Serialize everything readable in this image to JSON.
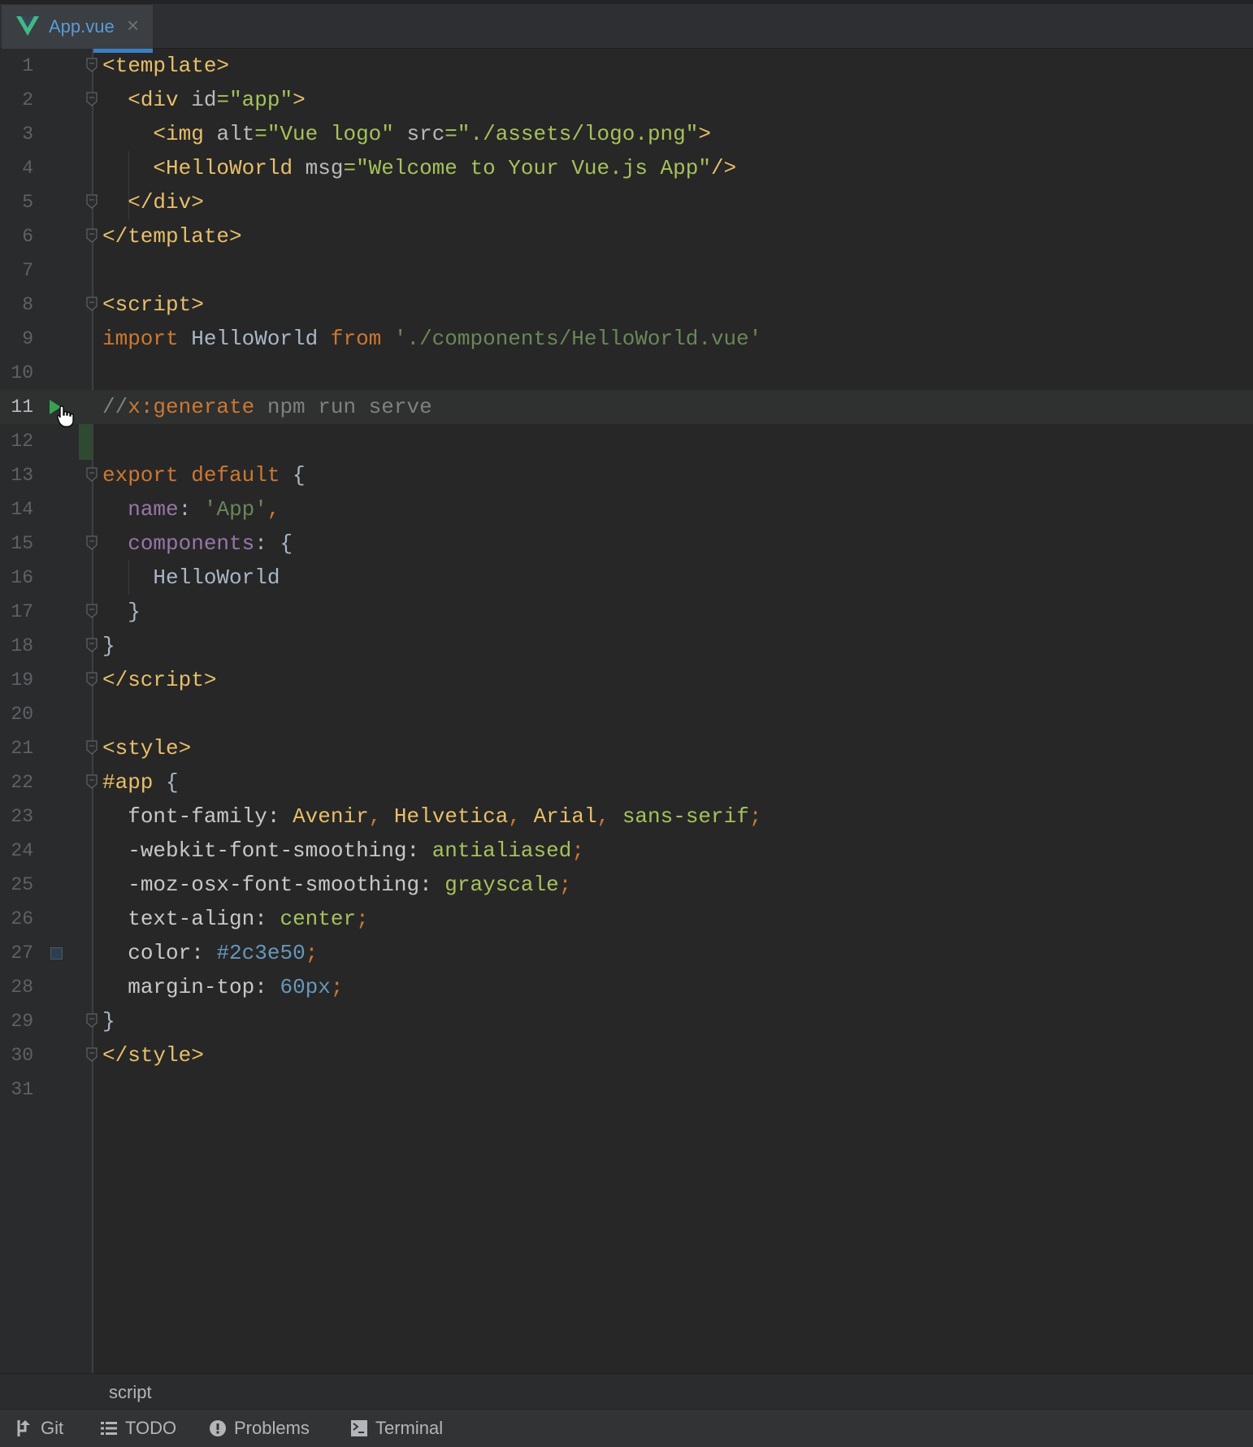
{
  "tab": {
    "label": "App.vue",
    "icon": "vue-logo-icon",
    "close_icon": "close-icon"
  },
  "lines": [
    [
      [
        "<template>",
        "tag"
      ]
    ],
    [
      [
        "  ",
        ""
      ],
      [
        "<div ",
        "tag"
      ],
      [
        "id",
        "attr"
      ],
      [
        "=",
        "str"
      ],
      [
        "\"app\"",
        "str"
      ],
      [
        ">",
        "tag"
      ]
    ],
    [
      [
        "    ",
        ""
      ],
      [
        "<img ",
        "tag"
      ],
      [
        "alt",
        "attr"
      ],
      [
        "=\"Vue logo\" ",
        "str"
      ],
      [
        "src",
        "attr"
      ],
      [
        "=\"./assets/logo.png\"",
        "str"
      ],
      [
        ">",
        "tag"
      ]
    ],
    [
      [
        "    ",
        ""
      ],
      [
        "<HelloWorld ",
        "tag"
      ],
      [
        "msg",
        "attr"
      ],
      [
        "=\"Welcome to Your Vue.js App\"",
        "str"
      ],
      [
        "/>",
        "tag"
      ]
    ],
    [
      [
        "  ",
        ""
      ],
      [
        "</div>",
        "tag"
      ]
    ],
    [
      [
        "</template>",
        "tag"
      ]
    ],
    [],
    [
      [
        "<script>",
        "tag"
      ]
    ],
    [
      [
        "import ",
        "kw"
      ],
      [
        "HelloWorld ",
        "id"
      ],
      [
        "from ",
        "kw"
      ],
      [
        "'./components/HelloWorld.vue'",
        "jstr"
      ]
    ],
    [],
    [
      [
        "//",
        "cmt"
      ],
      [
        "x:generate",
        "kw"
      ],
      [
        " npm run serve",
        "cmt"
      ]
    ],
    [],
    [
      [
        "export default ",
        "kw"
      ],
      [
        "{",
        "id"
      ]
    ],
    [
      [
        "  ",
        ""
      ],
      [
        "name",
        "prop"
      ],
      [
        ": ",
        "id"
      ],
      [
        "'App'",
        "jstr"
      ],
      [
        ",",
        "kw"
      ]
    ],
    [
      [
        "  ",
        ""
      ],
      [
        "components",
        "prop"
      ],
      [
        ": {",
        "id"
      ]
    ],
    [
      [
        "    ",
        ""
      ],
      [
        "HelloWorld",
        "id"
      ]
    ],
    [
      [
        "  ",
        ""
      ],
      [
        "}",
        "id"
      ]
    ],
    [
      [
        "}",
        "id"
      ]
    ],
    [
      [
        "</script>",
        "tag"
      ]
    ],
    [],
    [
      [
        "<style>",
        "tag"
      ]
    ],
    [
      [
        "#app ",
        "tag"
      ],
      [
        "{",
        "id"
      ]
    ],
    [
      [
        "  ",
        ""
      ],
      [
        "font-family",
        "cssp"
      ],
      [
        ": ",
        "cssp"
      ],
      [
        "Avenir",
        "font"
      ],
      [
        ", ",
        "kw"
      ],
      [
        "Helvetica",
        "font"
      ],
      [
        ", ",
        "kw"
      ],
      [
        "Arial",
        "font"
      ],
      [
        ", ",
        "kw"
      ],
      [
        "sans-serif",
        "val"
      ],
      [
        ";",
        "kw"
      ]
    ],
    [
      [
        "  ",
        ""
      ],
      [
        "-webkit-font-smoothing",
        "cssp"
      ],
      [
        ": ",
        "cssp"
      ],
      [
        "antialiased",
        "val"
      ],
      [
        ";",
        "kw"
      ]
    ],
    [
      [
        "  ",
        ""
      ],
      [
        "-moz-osx-font-smoothing",
        "cssp"
      ],
      [
        ": ",
        "cssp"
      ],
      [
        "grayscale",
        "val"
      ],
      [
        ";",
        "kw"
      ]
    ],
    [
      [
        "  ",
        ""
      ],
      [
        "text-align",
        "cssp"
      ],
      [
        ": ",
        "cssp"
      ],
      [
        "center",
        "val"
      ],
      [
        ";",
        "kw"
      ]
    ],
    [
      [
        "  ",
        ""
      ],
      [
        "color",
        "cssp"
      ],
      [
        ": ",
        "cssp"
      ],
      [
        "#2c3e50",
        "num"
      ],
      [
        ";",
        "kw"
      ]
    ],
    [
      [
        "  ",
        ""
      ],
      [
        "margin-top",
        "cssp"
      ],
      [
        ": ",
        "cssp"
      ],
      [
        "60px",
        "num"
      ],
      [
        ";",
        "kw"
      ]
    ],
    [
      [
        "}",
        "id"
      ]
    ],
    [
      [
        "</style>",
        "tag"
      ]
    ],
    []
  ],
  "current_line": 11,
  "fold_lines": [
    1,
    2,
    5,
    6,
    8,
    13,
    15,
    17,
    18,
    19,
    21,
    22,
    29,
    30
  ],
  "color_swatch": {
    "line": 27,
    "color": "#2c3e50"
  },
  "breadcrumb": "script",
  "tool_windows": [
    {
      "label": "Git",
      "icon": "git-branch-icon"
    },
    {
      "label": "TODO",
      "icon": "list-icon"
    },
    {
      "label": "Problems",
      "icon": "exclamation-icon"
    },
    {
      "label": "Terminal",
      "icon": "terminal-icon"
    }
  ]
}
